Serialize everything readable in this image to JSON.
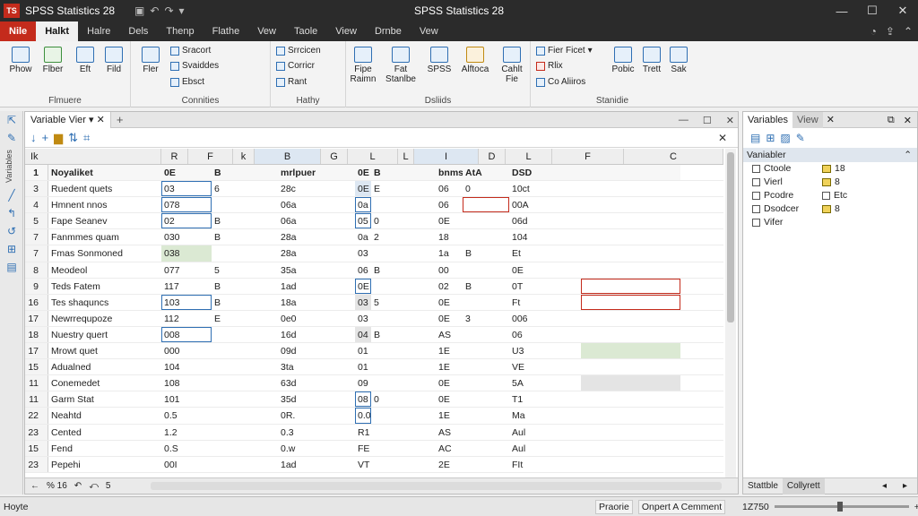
{
  "title_bar": {
    "app_name": "SPSS Statistics 28",
    "window_title": "SPSS Statistics 28",
    "logo_text": "TS"
  },
  "ribbon_tabs": [
    "Nile",
    "Halkt",
    "Halre",
    "Dels",
    "Thenp",
    "Flathe",
    "Vew",
    "Taole",
    "View",
    "Drnbe",
    "Vew"
  ],
  "ribbon": {
    "groups": [
      {
        "title": "Flmuere",
        "buttons": [
          "Phow",
          "Flber",
          "Eft",
          "Fild"
        ]
      },
      {
        "title": "Connities",
        "buttons": [
          "Fler"
        ],
        "small": [
          "Sracort",
          "Svaiddes",
          "Ebsct"
        ]
      },
      {
        "title": "Hathy",
        "small": [
          "Srrcicen",
          "Corricr",
          "Rant"
        ]
      },
      {
        "title": "Dsliids",
        "buttons": [
          "Fipe Raimn",
          "Fat Stanlbe",
          "SPSS",
          "Alftoca",
          "Cahlt Fie"
        ]
      },
      {
        "title": "Stanidie",
        "small": [
          "Fier Ficet",
          "Rlix",
          "Co Aliiros"
        ],
        "buttons": [
          "Pobic",
          "Trett",
          "Sak"
        ]
      }
    ]
  },
  "document": {
    "tab_label": "Variable Vier",
    "columns": [
      "R",
      "F",
      "k",
      "B",
      "G",
      "L",
      "L",
      "I",
      "D",
      "L",
      "F",
      "C"
    ],
    "corner_label": "Ik",
    "rows": [
      {
        "num": "1",
        "cells": [
          "Noyaliket",
          "0E",
          "B",
          "mrlpuer",
          "0E",
          "B",
          "bnms",
          "AtA",
          "DSD"
        ]
      },
      {
        "num": "3",
        "cells": [
          "Ruedent quets",
          "03",
          "6",
          "28c",
          "0E",
          "E",
          "06",
          "0",
          "10ct"
        ]
      },
      {
        "num": "4",
        "cells": [
          "Hmnent nnos",
          "078",
          "",
          "06a",
          "0a",
          "",
          "06",
          "",
          "00A"
        ]
      },
      {
        "num": "5",
        "cells": [
          "Fape Seanev",
          "02",
          "B",
          "06a",
          "05",
          "0",
          "0E",
          "",
          "06d"
        ]
      },
      {
        "num": "7",
        "cells": [
          "Fanmmes quam",
          "030",
          "B",
          "28a",
          "0a",
          "2",
          "18",
          "",
          "104"
        ]
      },
      {
        "num": "7",
        "cells": [
          "Fmas Sonmoned",
          "038",
          "",
          "28a",
          "03",
          "",
          "1a",
          "B",
          "Et"
        ]
      },
      {
        "num": "8",
        "cells": [
          "Meodeol",
          "077",
          "5",
          "35a",
          "06",
          "B",
          "00",
          "",
          "0E"
        ]
      },
      {
        "num": "9",
        "cells": [
          "Teds Fatem",
          "117",
          "B",
          "1ad",
          "0E",
          "",
          "02",
          "B",
          "0T"
        ]
      },
      {
        "num": "16",
        "cells": [
          "Tes shaquncs",
          "103",
          "B",
          "18a",
          "03",
          "5",
          "0E",
          "",
          "Ft"
        ]
      },
      {
        "num": "17",
        "cells": [
          "Newrrequpoze",
          "112",
          "E",
          "0e0",
          "03",
          "",
          "0E",
          "3",
          "006"
        ]
      },
      {
        "num": "18",
        "cells": [
          "Nuestry quert",
          "008",
          "",
          "16d",
          "04",
          "B",
          "AS",
          "",
          "06"
        ]
      },
      {
        "num": "17",
        "cells": [
          "Mrowt quet",
          "000",
          "",
          "09d",
          "01",
          "",
          "1E",
          "",
          "U3"
        ]
      },
      {
        "num": "15",
        "cells": [
          "Adualned",
          "104",
          "",
          "3ta",
          "01",
          "",
          "1E",
          "",
          "VE"
        ]
      },
      {
        "num": "11",
        "cells": [
          "Conemedet",
          "108",
          "",
          "63d",
          "09",
          "",
          "0E",
          "",
          "5A"
        ]
      },
      {
        "num": "11",
        "cells": [
          "Garm Stat",
          "101",
          "",
          "35d",
          "08",
          "0",
          "0E",
          "",
          "T1"
        ]
      },
      {
        "num": "22",
        "cells": [
          "Neahtd",
          "0.5",
          "",
          "0R.",
          "0.0",
          "",
          "1E",
          "",
          "Ma"
        ]
      },
      {
        "num": "23",
        "cells": [
          "Cented",
          "1.2",
          "",
          "0.3",
          "R1",
          "",
          "AS",
          "",
          "Aul"
        ]
      },
      {
        "num": "15",
        "cells": [
          "Fend",
          "0.S",
          "",
          "0.w",
          "FE",
          "",
          "AC",
          "",
          "Aul"
        ]
      },
      {
        "num": "23",
        "cells": [
          "Pepehi",
          "00I",
          "",
          "1ad",
          "VT",
          "",
          "2E",
          "",
          "FIt"
        ]
      }
    ],
    "bottom_bar": {
      "label": "% 16",
      "page": "5"
    }
  },
  "right_panel": {
    "tab_active": "Variables",
    "tab_other": "View",
    "section": "Vaniabler",
    "items": [
      {
        "label": "Ctoole",
        "value": "18"
      },
      {
        "label": "Vierl",
        "value": "8"
      },
      {
        "label": "Pcodre",
        "value": "Etc"
      },
      {
        "label": "Dsodcer",
        "value": "8"
      },
      {
        "label": "Vifer",
        "value": ""
      }
    ],
    "bottom_tabs": [
      "Stattble",
      "Collyrett"
    ]
  },
  "status_bar": {
    "left": "Hoyte",
    "mid": [
      "Praorie",
      "Onpert A Cemment"
    ],
    "zoom": "1Z750"
  }
}
